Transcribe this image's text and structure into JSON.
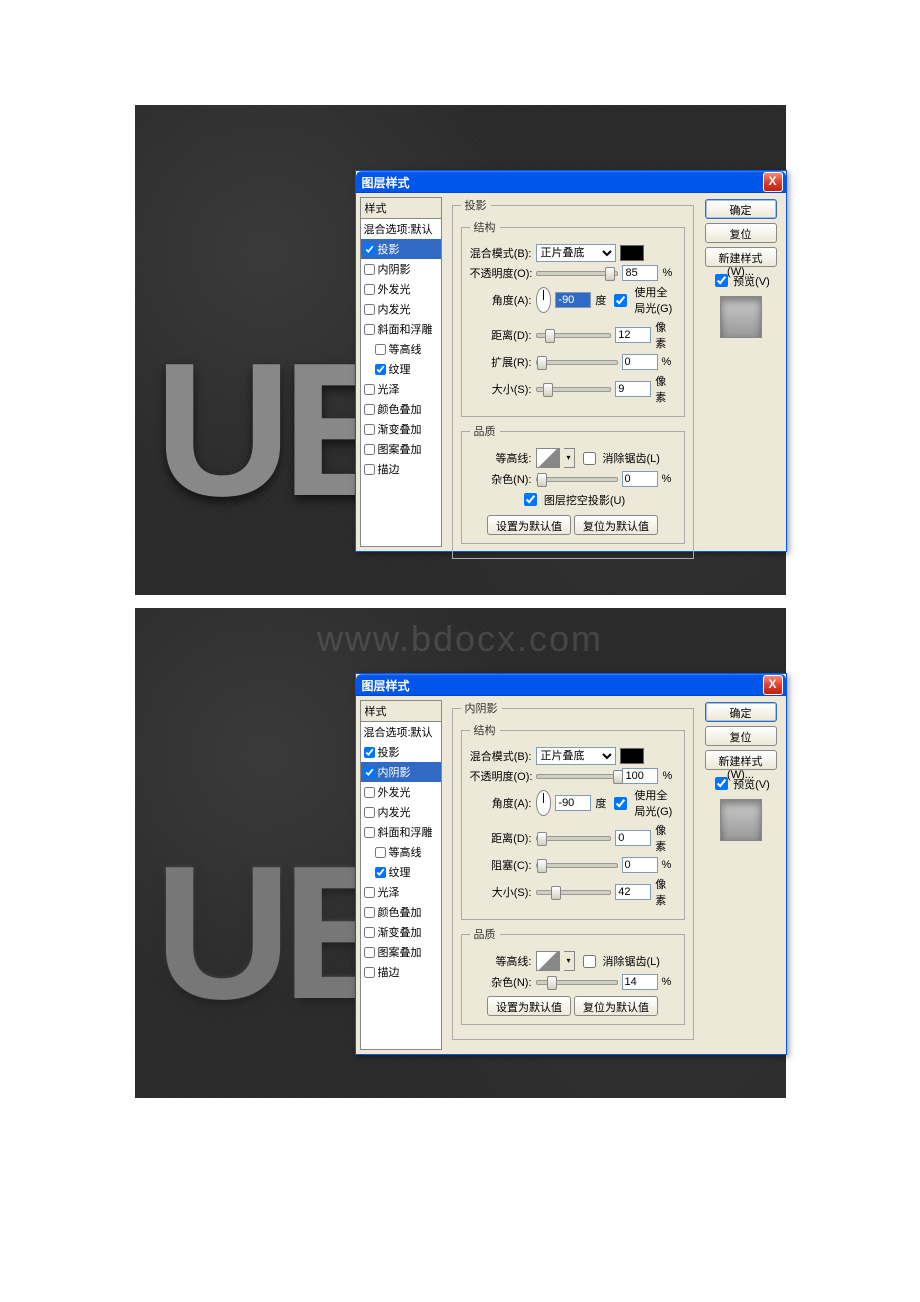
{
  "watermark": "www.bdocx.com",
  "dialog_title": "图层样式",
  "close_icon": "X",
  "styles_header": "样式",
  "styles": [
    {
      "label": "混合选项:默认",
      "checkbox": false
    },
    {
      "label": "投影",
      "checkbox": true,
      "checked": true
    },
    {
      "label": "内阴影",
      "checkbox": true,
      "checked": false
    },
    {
      "label": "外发光",
      "checkbox": true,
      "checked": false
    },
    {
      "label": "内发光",
      "checkbox": true,
      "checked": false
    },
    {
      "label": "斜面和浮雕",
      "checkbox": true,
      "checked": false
    },
    {
      "label": "等高线",
      "checkbox": true,
      "checked": false,
      "indent": true
    },
    {
      "label": "纹理",
      "checkbox": true,
      "checked": true,
      "indent": true
    },
    {
      "label": "光泽",
      "checkbox": true,
      "checked": false
    },
    {
      "label": "颜色叠加",
      "checkbox": true,
      "checked": false
    },
    {
      "label": "渐变叠加",
      "checkbox": true,
      "checked": false
    },
    {
      "label": "图案叠加",
      "checkbox": true,
      "checked": false
    },
    {
      "label": "描边",
      "checkbox": true,
      "checked": false
    }
  ],
  "panel1": {
    "section": "投影",
    "structure": "结构",
    "blend_mode_label": "混合模式(B):",
    "blend_mode_value": "正片叠底",
    "opacity_label": "不透明度(O):",
    "opacity_value": "85",
    "opacity_unit": "%",
    "angle_label": "角度(A):",
    "angle_value": "-90",
    "angle_unit": "度",
    "global_light": "使用全局光(G)",
    "distance_label": "距离(D):",
    "distance_value": "12",
    "distance_unit": "像素",
    "spread_label": "扩展(R):",
    "spread_value": "0",
    "spread_unit": "%",
    "size_label": "大小(S):",
    "size_value": "9",
    "size_unit": "像素",
    "quality": "品质",
    "contour_label": "等高线:",
    "antialias": "消除锯齿(L)",
    "noise_label": "杂色(N):",
    "noise_value": "0",
    "noise_unit": "%",
    "knockout": "图层挖空投影(U)",
    "set_default": "设置为默认值",
    "reset_default": "复位为默认值"
  },
  "panel2": {
    "section": "内阴影",
    "structure": "结构",
    "blend_mode_label": "混合模式(B):",
    "blend_mode_value": "正片叠底",
    "opacity_label": "不透明度(O):",
    "opacity_value": "100",
    "opacity_unit": "%",
    "angle_label": "角度(A):",
    "angle_value": "-90",
    "angle_unit": "度",
    "global_light": "使用全局光(G)",
    "distance_label": "距离(D):",
    "distance_value": "0",
    "distance_unit": "像素",
    "choke_label": "阻塞(C):",
    "choke_value": "0",
    "choke_unit": "%",
    "size_label": "大小(S):",
    "size_value": "42",
    "size_unit": "像素",
    "quality": "品质",
    "contour_label": "等高线:",
    "antialias": "消除锯齿(L)",
    "noise_label": "杂色(N):",
    "noise_value": "14",
    "noise_unit": "%",
    "set_default": "设置为默认值",
    "reset_default": "复位为默认值"
  },
  "buttons": {
    "ok": "确定",
    "cancel": "复位",
    "new_style": "新建样式(W)...",
    "preview": "预览(V)"
  }
}
